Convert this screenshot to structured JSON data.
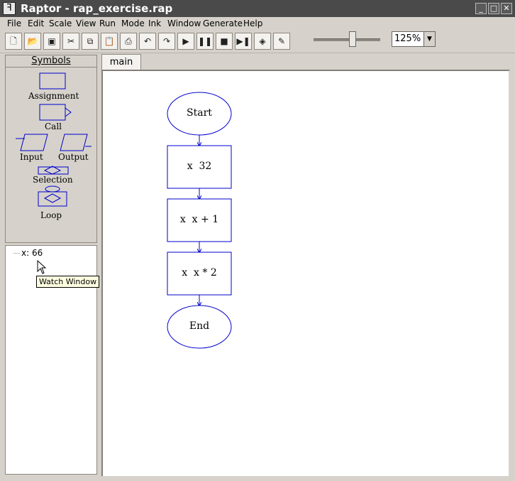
{
  "window": {
    "title": "Raptor - rap_exercise.rap",
    "app_icon": "raptor-icon",
    "controls": [
      "minimize-icon",
      "maximize-icon",
      "close-icon"
    ]
  },
  "menu": [
    "File",
    "Edit",
    "Scale",
    "View",
    "Run",
    "Mode",
    "Ink",
    "Window",
    "Generate",
    "Help"
  ],
  "toolbar": {
    "buttons": [
      "new-file-icon",
      "open-folder-icon",
      "save-icon",
      "cut-icon",
      "copy-icon",
      "paste-icon",
      "print-icon",
      "undo-icon",
      "redo-icon",
      "run-icon",
      "pause-icon",
      "stop-icon",
      "step-icon",
      "test-server-icon",
      "ink-pen-icon"
    ],
    "zoom": "125%"
  },
  "symbols": {
    "header": "Symbols",
    "assignment": "Assignment",
    "call": "Call",
    "input": "Input",
    "output": "Output",
    "selection": "Selection",
    "loop": "Loop"
  },
  "watch": {
    "items": [
      "x: 66"
    ],
    "tooltip": "Watch Window"
  },
  "tabs": [
    "main"
  ],
  "flowchart": {
    "start": "Start",
    "step1": "x  32",
    "step2": "x  x + 1",
    "step3": "x  x * 2",
    "end": "End",
    "line_color": "#0000cc"
  }
}
